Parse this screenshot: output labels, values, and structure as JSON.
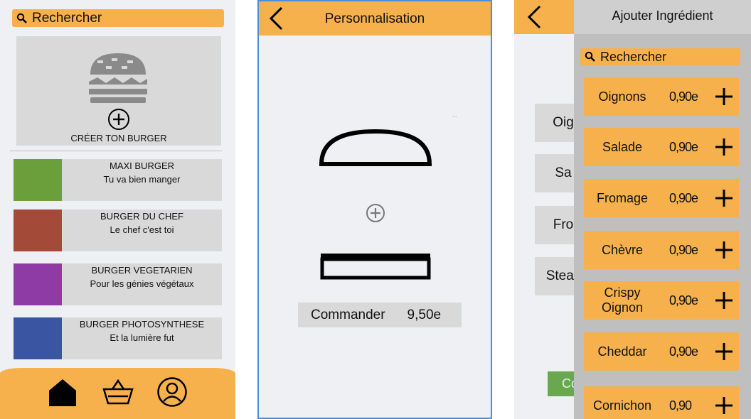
{
  "screen1": {
    "search": {
      "placeholder": "Rechercher"
    },
    "create": {
      "label": "CRÉER TON BURGER"
    },
    "burgers": [
      {
        "name": "MAXI BURGER",
        "tagline": "Tu va bien manger",
        "color": "#6a9f3c"
      },
      {
        "name": "BURGER DU CHEF",
        "tagline": "Le chef c'est toi",
        "color": "#a34a39"
      },
      {
        "name": "BURGER VEGETARIEN",
        "tagline": "Pour les génies végétaux",
        "color": "#8f3ba6"
      },
      {
        "name": "BURGER PHOTOSYNTHESE",
        "tagline": "Et la lumière fut",
        "color": "#3a56a3"
      }
    ],
    "nav": [
      "home-icon",
      "basket-icon",
      "profile-icon"
    ]
  },
  "screen2": {
    "title": "Personnalisation",
    "order": {
      "label": "Commander",
      "price": "9,50e"
    },
    "dots": "..."
  },
  "screen3": {
    "background_rows": [
      "Oig",
      "Sa",
      "Fro",
      "Steak"
    ],
    "background_button": "Co",
    "panel": {
      "title": "Ajouter Ingrédient",
      "search_placeholder": "Rechercher",
      "ingredients": [
        {
          "name": "Oignons",
          "price": "0,90e"
        },
        {
          "name": "Salade",
          "price": "0,90e"
        },
        {
          "name": "Fromage",
          "price": "0,90e"
        },
        {
          "name": "Chèvre",
          "price": "0,90e"
        },
        {
          "name": "Crispy\nOignon",
          "price": "0,90e"
        },
        {
          "name": "Cheddar",
          "price": "0,90e"
        },
        {
          "name": "Cornichon",
          "price": "0,90"
        }
      ]
    }
  },
  "colors": {
    "accent": "#f6b14c",
    "card": "#d9d9d9",
    "screen_bg": "#eef0f4"
  }
}
